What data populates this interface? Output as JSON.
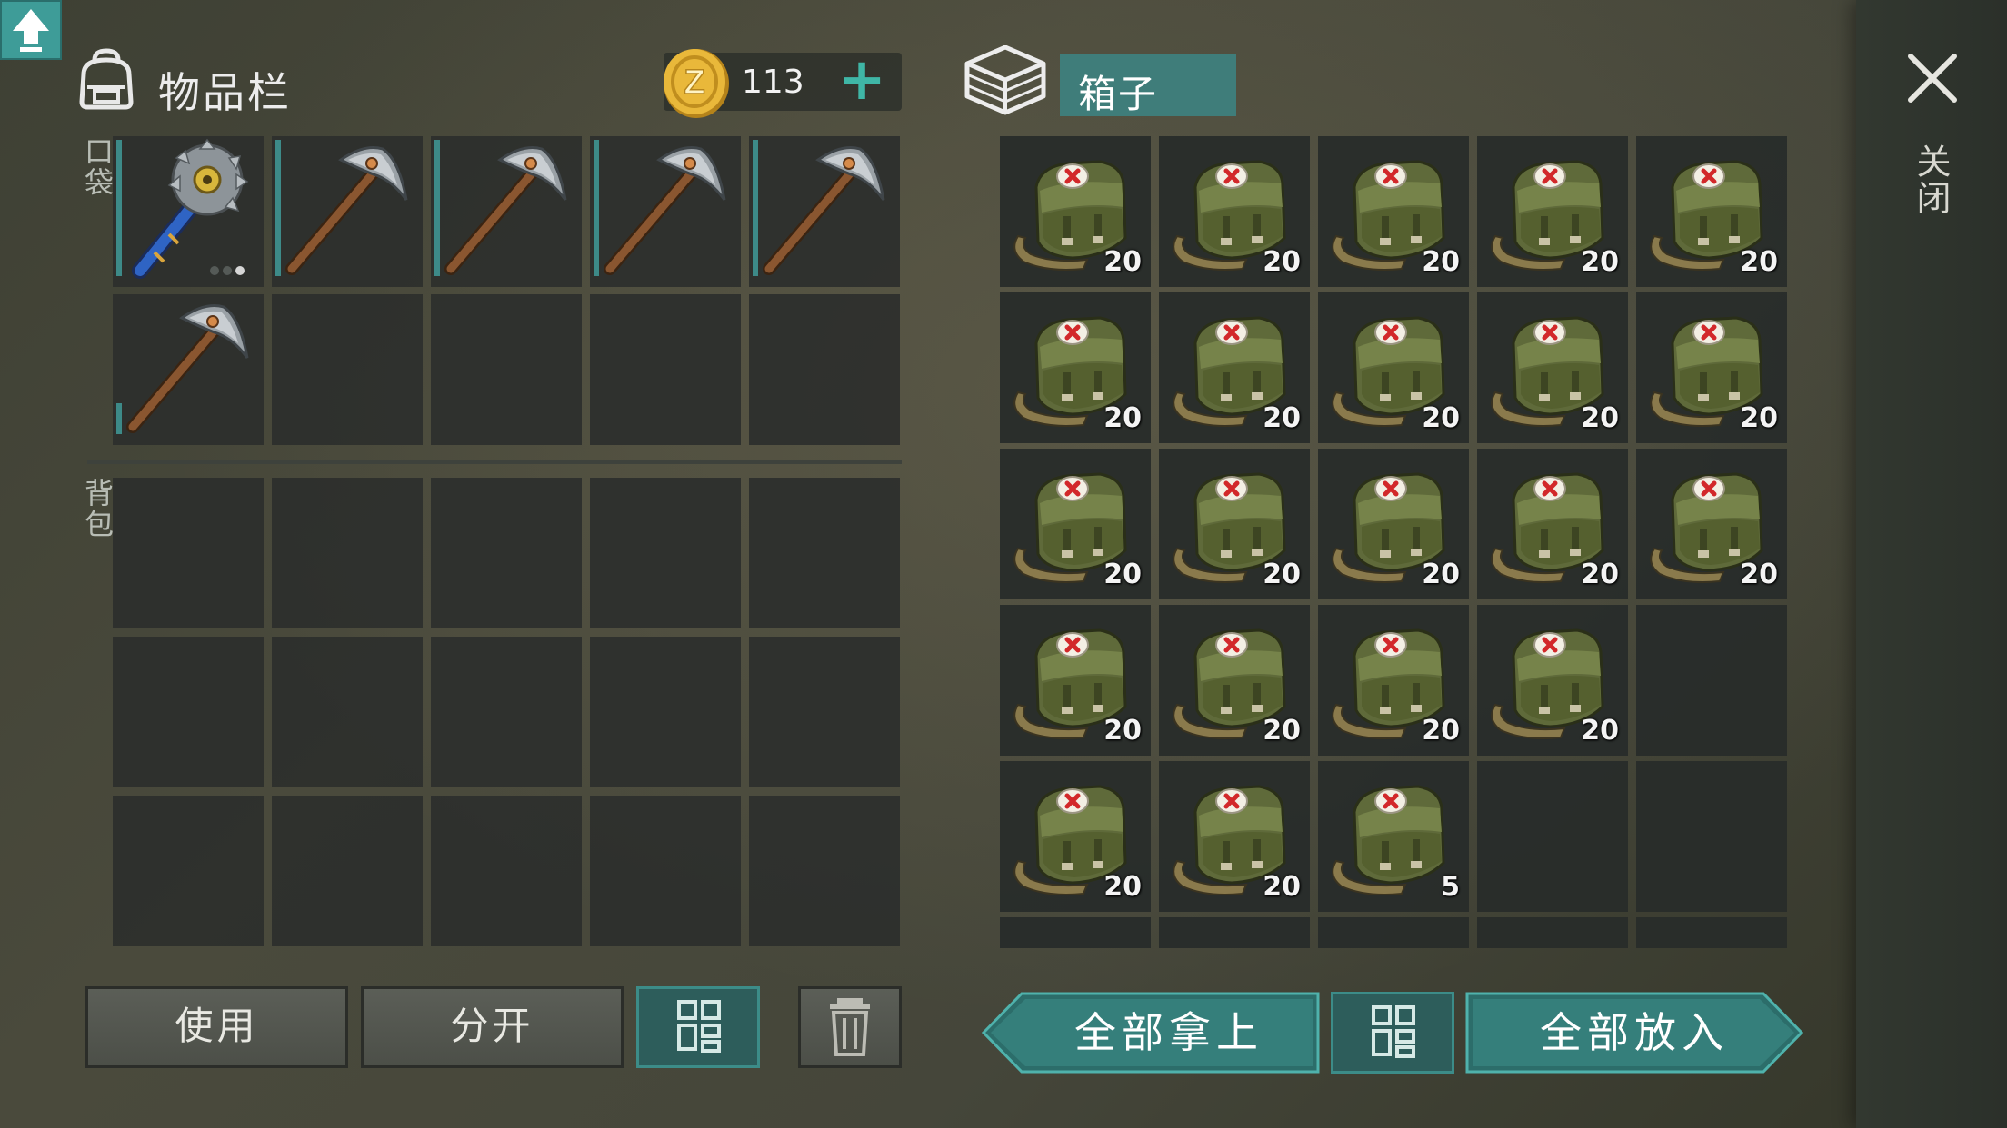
{
  "inventory": {
    "title": "物品栏",
    "coins": "113",
    "pocket_label": "口袋",
    "backpack_label": "背包",
    "pocket_slots": [
      {
        "item": "saw-mace",
        "qty": ""
      },
      {
        "item": "pickaxe",
        "qty": ""
      },
      {
        "item": "pickaxe",
        "qty": ""
      },
      {
        "item": "pickaxe",
        "qty": ""
      },
      {
        "item": "pickaxe",
        "qty": ""
      },
      {
        "item": "pickaxe",
        "qty": ""
      },
      {
        "item": "",
        "qty": ""
      },
      {
        "item": "",
        "qty": ""
      },
      {
        "item": "",
        "qty": ""
      },
      {
        "item": "",
        "qty": ""
      }
    ],
    "backpack_slots": 15,
    "buttons": {
      "use": "使用",
      "split": "分开",
      "sort_icon": "grid-sort-icon",
      "trash_icon": "trash-icon"
    }
  },
  "chest": {
    "title": "箱子",
    "slots": [
      {
        "item": "medical-bag",
        "qty": "20"
      },
      {
        "item": "medical-bag",
        "qty": "20"
      },
      {
        "item": "medical-bag",
        "qty": "20"
      },
      {
        "item": "medical-bag",
        "qty": "20"
      },
      {
        "item": "medical-bag",
        "qty": "20"
      },
      {
        "item": "medical-bag",
        "qty": "20"
      },
      {
        "item": "medical-bag",
        "qty": "20"
      },
      {
        "item": "medical-bag",
        "qty": "20"
      },
      {
        "item": "medical-bag",
        "qty": "20"
      },
      {
        "item": "medical-bag",
        "qty": "20"
      },
      {
        "item": "medical-bag",
        "qty": "20"
      },
      {
        "item": "medical-bag",
        "qty": "20"
      },
      {
        "item": "medical-bag",
        "qty": "20"
      },
      {
        "item": "medical-bag",
        "qty": "20"
      },
      {
        "item": "medical-bag",
        "qty": "20"
      },
      {
        "item": "medical-bag",
        "qty": "20"
      },
      {
        "item": "medical-bag",
        "qty": "20"
      },
      {
        "item": "medical-bag",
        "qty": "20"
      },
      {
        "item": "medical-bag",
        "qty": "20"
      },
      {
        "item": "",
        "qty": ""
      },
      {
        "item": "medical-bag",
        "qty": "20"
      },
      {
        "item": "medical-bag",
        "qty": "20"
      },
      {
        "item": "medical-bag",
        "qty": "5"
      },
      {
        "item": "",
        "qty": ""
      },
      {
        "item": "",
        "qty": ""
      },
      {
        "item": "",
        "qty": ""
      },
      {
        "item": "",
        "qty": ""
      },
      {
        "item": "",
        "qty": ""
      },
      {
        "item": "",
        "qty": ""
      },
      {
        "item": "",
        "qty": ""
      }
    ],
    "buttons": {
      "take_all": "全部拿上",
      "put_all": "全部放入",
      "sort_icon": "grid-sort-icon",
      "upload_icon": "arrow-up-icon"
    }
  },
  "close": {
    "label": "关闭",
    "icon": "close-icon"
  },
  "colors": {
    "accent_teal": "#3e9c98",
    "slot_bg": "#2c2f2c",
    "durability_bar": "#3d8a88"
  }
}
